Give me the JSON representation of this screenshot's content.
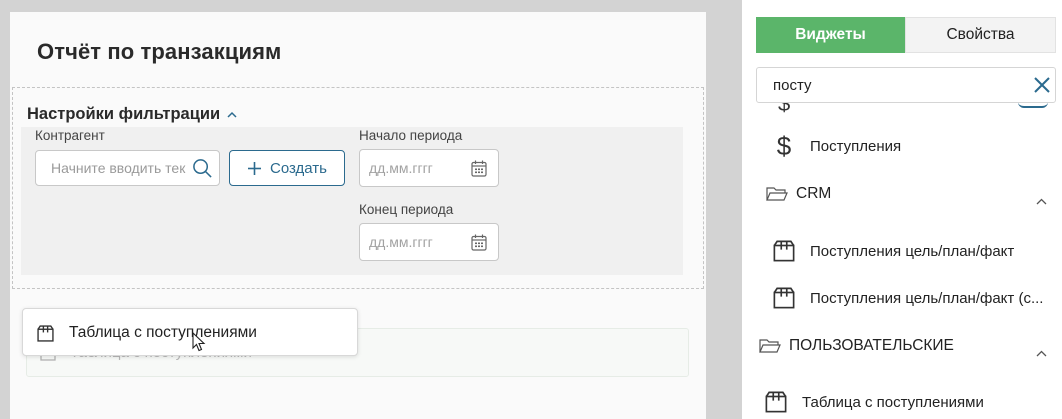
{
  "page": {
    "title": "Отчёт по транзакциям"
  },
  "filter": {
    "header": "Настройки фильтрации",
    "counterparty_label": "Контрагент",
    "counterparty_placeholder": "Начните вводить текст",
    "create_label": "Создать",
    "period_start_label": "Начало периода",
    "period_start_placeholder": "дд.мм.гггг",
    "period_end_label": "Конец периода",
    "period_end_placeholder": "дд.мм.гггг"
  },
  "canvas": {
    "drop_zone_label": "Таблица с поступлениями",
    "drag_ghost_label": "Таблица с поступлениями"
  },
  "panel": {
    "tabs": [
      {
        "label": "Виджеты",
        "active": true
      },
      {
        "label": "Свойства",
        "active": false
      }
    ],
    "search_value": "посту",
    "items": {
      "receipts": "Поступления",
      "crm_folder": "CRM",
      "crm_item_1": "Поступления цель/план/факт",
      "crm_item_2": "Поступления цель/план/факт (с...",
      "custom_folder": "ПОЛЬЗОВАТЕЛЬСКИЕ",
      "custom_item_1": "Таблица с поступлениями"
    }
  },
  "colors": {
    "accent_green": "#5bb56a",
    "accent_blue": "#2b6a8e"
  },
  "icons": {
    "search": "magnifier-icon",
    "calendar": "calendar-icon",
    "widget": "box-icon",
    "folder": "folder-icon",
    "currency": "dollar-icon"
  }
}
